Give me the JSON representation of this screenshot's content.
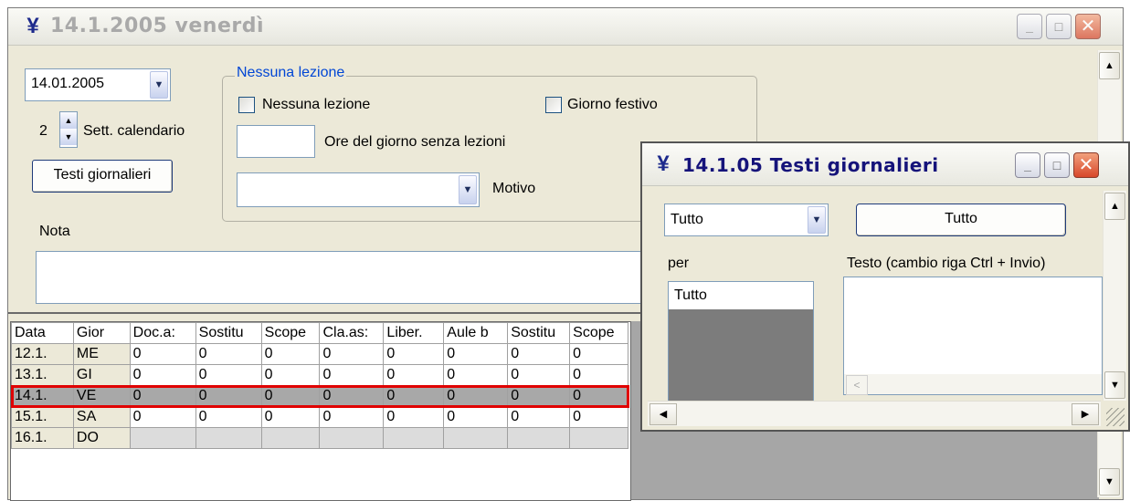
{
  "main_window": {
    "title": "14.1.2005 venerdì",
    "date_value": "14.01.2005",
    "week_number": "2",
    "week_label": "Sett. calendario",
    "daily_texts_button": "Testi giornalieri",
    "note_label": "Nota",
    "note_value": "",
    "group": {
      "title": "Nessuna lezione",
      "no_lesson_checkbox": "Nessuna lezione",
      "holiday_checkbox": "Giorno festivo",
      "hours_value": "",
      "hours_label": "Ore del giorno senza lezioni",
      "reason_value": "",
      "reason_label": "Motivo"
    },
    "table": {
      "columns": [
        "Data",
        "Gior",
        "Doc.a:",
        "Sostitu",
        "Scope",
        "Cla.as:",
        "Liber.",
        "Aule b",
        "Sostitu",
        "Scope"
      ],
      "rows": [
        {
          "date": "12.1.",
          "day": "ME",
          "values": [
            "0",
            "0",
            "0",
            "0",
            "0",
            "0",
            "0",
            "0"
          ]
        },
        {
          "date": "13.1.",
          "day": "GI",
          "values": [
            "0",
            "0",
            "0",
            "0",
            "0",
            "0",
            "0",
            "0"
          ]
        },
        {
          "date": "14.1.",
          "day": "VE",
          "values": [
            "0",
            "0",
            "0",
            "0",
            "0",
            "0",
            "0",
            "0"
          ],
          "selected": true
        },
        {
          "date": "15.1.",
          "day": "SA",
          "values": [
            "0",
            "0",
            "0",
            "0",
            "0",
            "0",
            "0",
            "0"
          ]
        },
        {
          "date": "16.1.",
          "day": "DO",
          "values": [
            "",
            "",
            "",
            "",
            "",
            "",
            "",
            ""
          ]
        }
      ]
    }
  },
  "popup_window": {
    "title": "14.1.05 Testi giornalieri",
    "filter_value": "Tutto",
    "filter_button": "Tutto",
    "for_label": "per",
    "for_list": [
      "Tutto"
    ],
    "text_label": "Testo (cambio riga Ctrl + Invio)",
    "text_value": ""
  },
  "colors": {
    "window_bg": "#ece9d8",
    "active_title": "#15137a",
    "group_title": "#0046d5",
    "selection_outline": "#e00000",
    "close_button": "#d8472a"
  }
}
